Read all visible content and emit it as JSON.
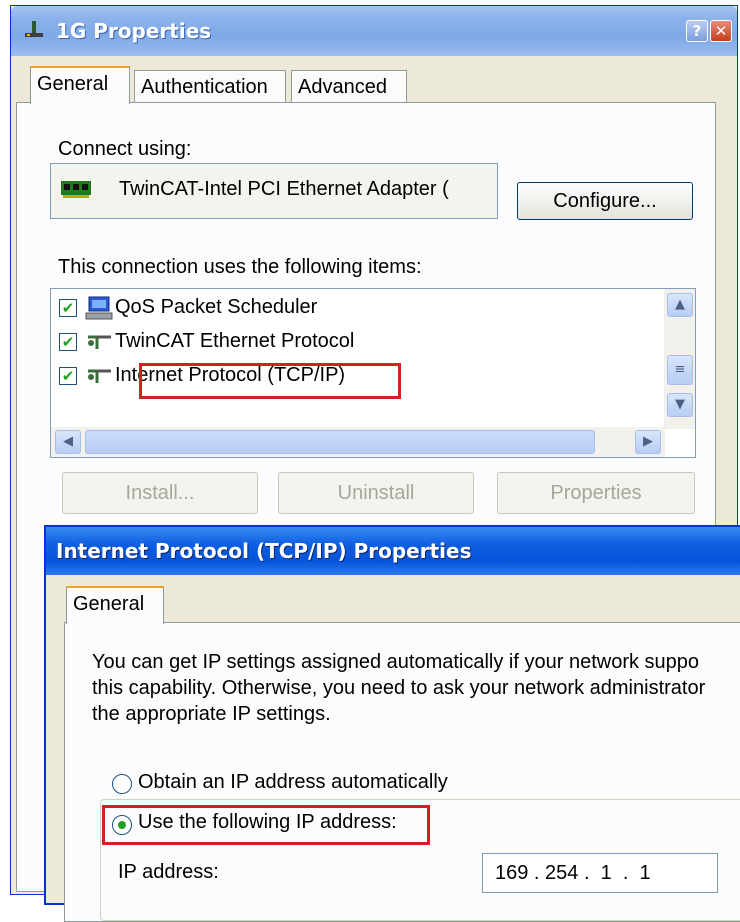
{
  "outer": {
    "title": "1G Properties",
    "tabs": [
      "General",
      "Authentication",
      "Advanced"
    ],
    "connect_using_label": "Connect using:",
    "adapter_name": "TwinCAT-Intel PCI Ethernet Adapter (",
    "configure_label": "Configure...",
    "items_label": "This connection uses the following items:",
    "items": [
      {
        "label": "QoS Packet Scheduler",
        "checked": true,
        "icon": "qos-scheduler-icon"
      },
      {
        "label": "TwinCAT Ethernet Protocol",
        "checked": true,
        "icon": "network-protocol-icon"
      },
      {
        "label": "Internet Protocol (TCP/IP)",
        "checked": true,
        "icon": "network-protocol-icon"
      }
    ],
    "buttons": {
      "install": "Install...",
      "uninstall": "Uninstall",
      "properties": "Properties"
    }
  },
  "inner": {
    "title": "Internet Protocol (TCP/IP) Properties",
    "tab": "General",
    "description": [
      "You can get IP settings assigned automatically if your network suppo",
      "this capability. Otherwise, you need to ask your network administrator",
      "the appropriate IP settings."
    ],
    "option_auto": "Obtain an IP address automatically",
    "option_manual": "Use the following IP address:",
    "selected_option": "manual",
    "ip_label": "IP address:",
    "ip_value": "169 . 254 .  1  .  1"
  },
  "colors": {
    "highlight": "#d42020",
    "xp_blue": "#0553d8"
  }
}
